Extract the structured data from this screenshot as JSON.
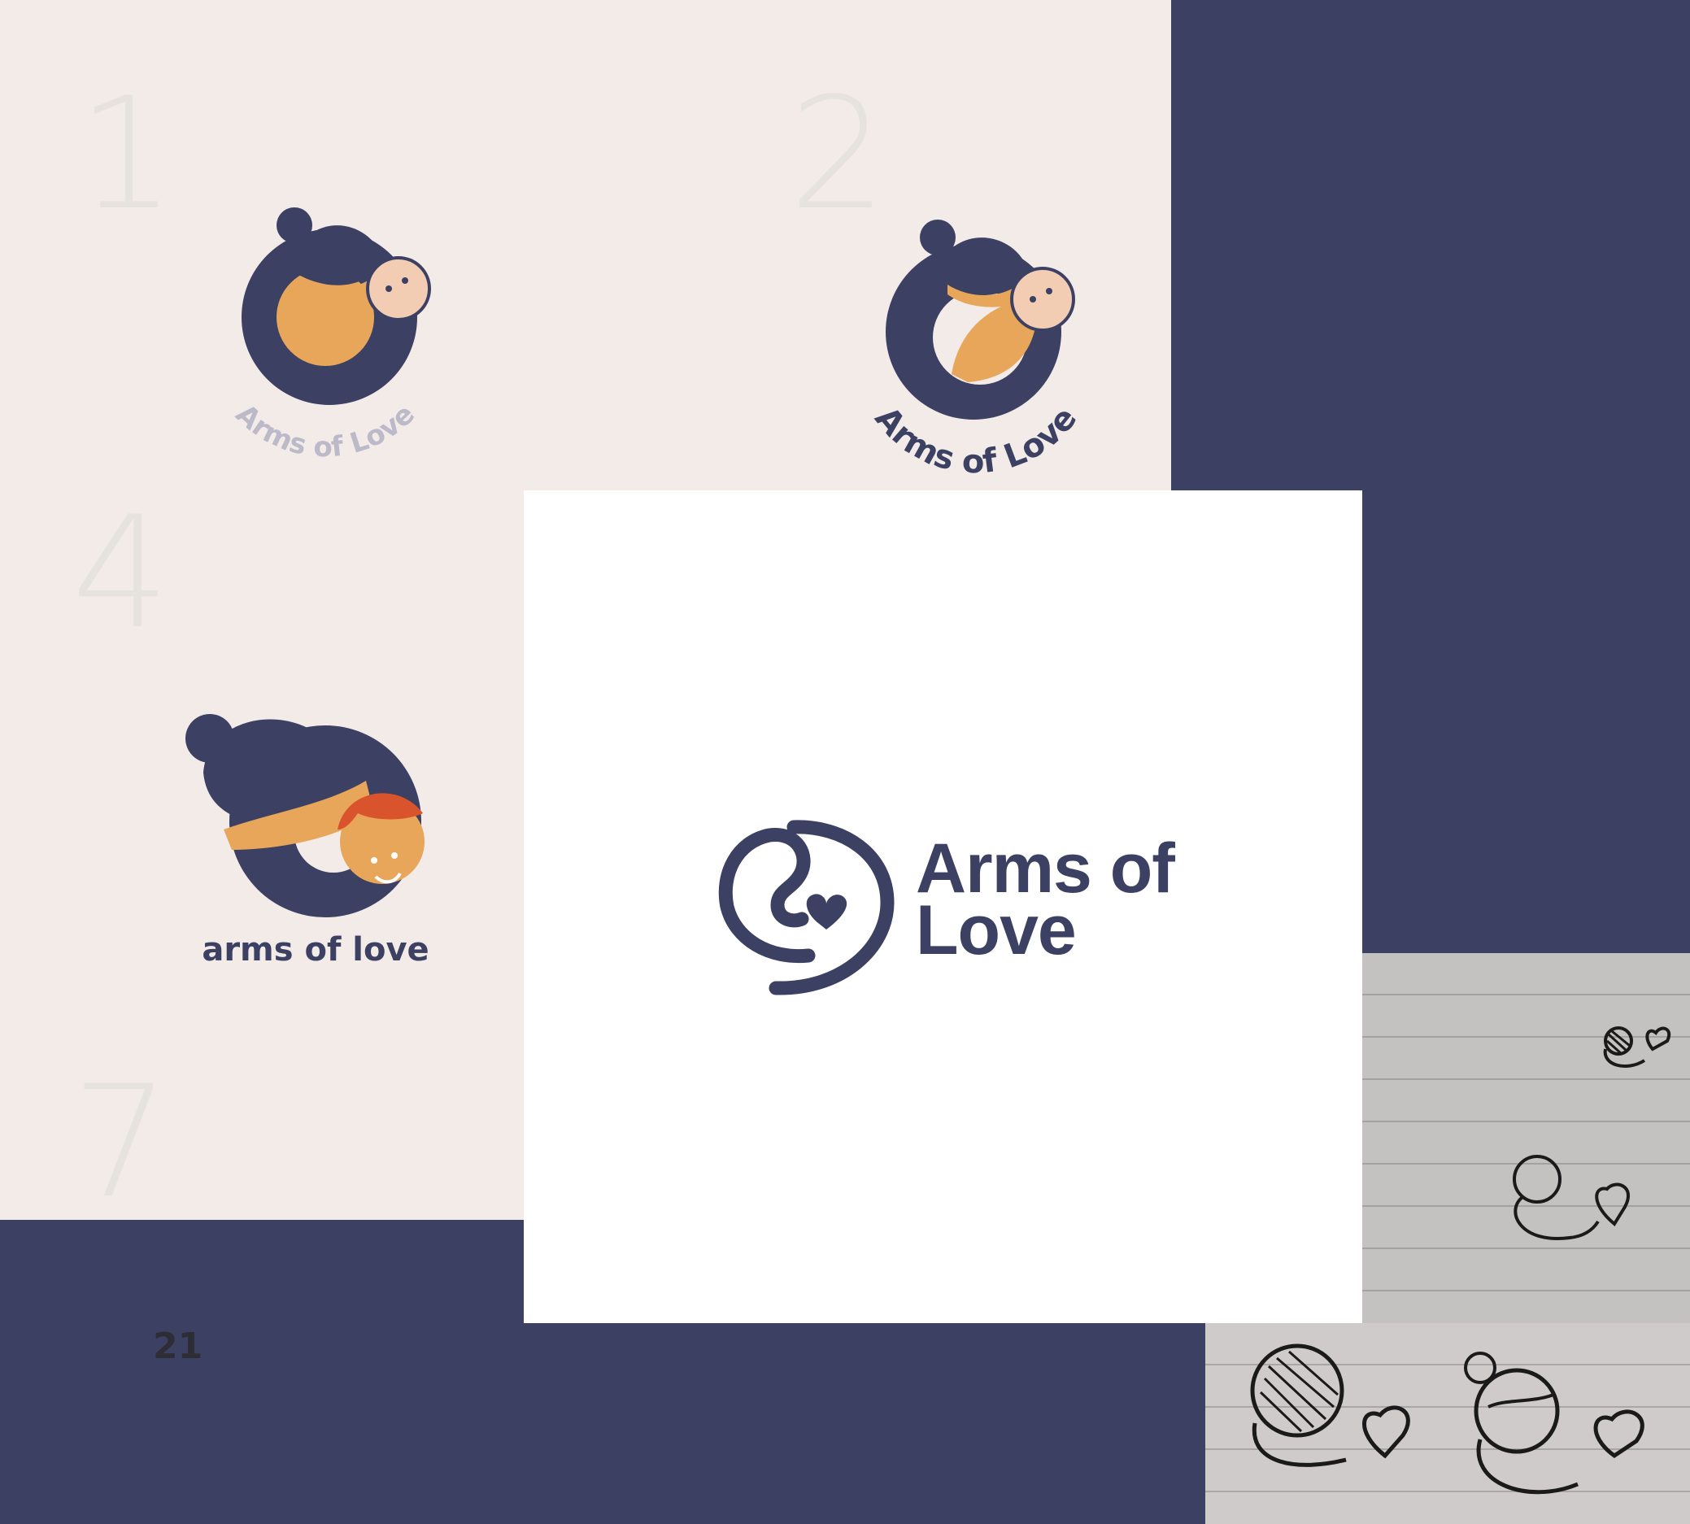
{
  "concepts": [
    {
      "number": "1",
      "wordmark": "Arms of Love"
    },
    {
      "number": "2",
      "wordmark": "Arms of Love"
    },
    {
      "number": "4",
      "wordmark": "arms of love"
    },
    {
      "number": "7"
    }
  ],
  "final_logo": {
    "line1": "Arms of",
    "line2": "Love",
    "color": "#3c4063"
  },
  "page_number": "21",
  "colors": {
    "navy": "#3c4063",
    "orange": "#e8a65a",
    "skin": "#f2cdb4",
    "red_hair": "#d9532c",
    "cream": "#f3ebe8"
  }
}
